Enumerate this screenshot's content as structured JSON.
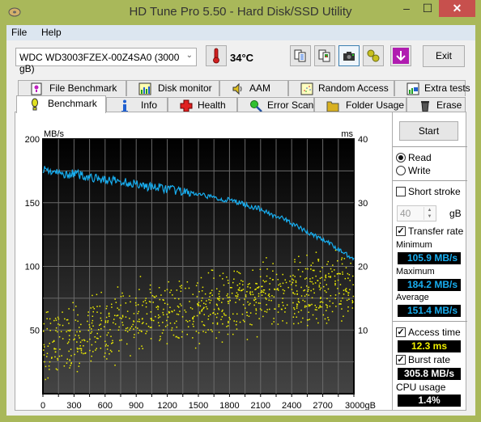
{
  "window": {
    "title": "HD Tune Pro 5.50 - Hard Disk/SSD Utility",
    "minimize_glyph": "–",
    "maximize_glyph": "☐",
    "close_glyph": "✕"
  },
  "menu": {
    "items": [
      {
        "label": "File"
      },
      {
        "label": "Help"
      }
    ]
  },
  "toolbar": {
    "drive": "WDC WD3003FZEX-00Z4SA0 (3000 gB)",
    "temperature": "34°C",
    "buttons": [
      {
        "icon": "copy-text-icon"
      },
      {
        "icon": "copy-screenshot-icon"
      },
      {
        "icon": "camera-icon"
      },
      {
        "icon": "options-icon"
      },
      {
        "icon": "save-down-icon"
      }
    ],
    "exit_label": "Exit"
  },
  "tabs": {
    "top_row": [
      {
        "label": "File Benchmark",
        "icon": "file-benchmark-icon"
      },
      {
        "label": "Disk monitor",
        "icon": "disk-monitor-icon"
      },
      {
        "label": "AAM",
        "icon": "speaker-icon"
      },
      {
        "label": "Random Access",
        "icon": "random-access-icon"
      },
      {
        "label": "Extra tests",
        "icon": "extra-tests-icon"
      }
    ],
    "bottom_row": [
      {
        "label": "Benchmark",
        "icon": "benchmark-icon",
        "active": true
      },
      {
        "label": "Info",
        "icon": "info-icon"
      },
      {
        "label": "Health",
        "icon": "health-cross-icon"
      },
      {
        "label": "Error Scan",
        "icon": "magnifier-icon"
      },
      {
        "label": "Folder Usage",
        "icon": "folder-icon"
      },
      {
        "label": "Erase",
        "icon": "trash-icon"
      }
    ]
  },
  "side": {
    "start_label": "Start",
    "read_label": "Read",
    "write_label": "Write",
    "mode_selected": "Read",
    "short_stroke_label": "Short stroke",
    "short_stroke_checked": false,
    "short_stroke_value": "40",
    "short_stroke_unit": "gB",
    "transfer_rate_label": "Transfer rate",
    "transfer_rate_checked": true,
    "minimum_label": "Minimum",
    "minimum_value": "105.9 MB/s",
    "maximum_label": "Maximum",
    "maximum_value": "184.2 MB/s",
    "average_label": "Average",
    "average_value": "151.4 MB/s",
    "access_time_label": "Access time",
    "access_time_checked": true,
    "access_time_value": "12.3 ms",
    "burst_rate_label": "Burst rate",
    "burst_rate_checked": true,
    "burst_rate_value": "305.8 MB/s",
    "cpu_label": "CPU usage",
    "cpu_value": "1.4%"
  },
  "colors": {
    "transfer_line": "#18aef0",
    "access_dots": "#f0f000",
    "plot_bg_top": "#000000",
    "plot_bg_bottom": "#444444",
    "grid": "#6a6a6a"
  },
  "chart_data": {
    "type": "line",
    "title": "",
    "xlabel": "gB",
    "ylabel_left": "MB/s",
    "ylabel_right": "ms",
    "xlim": [
      0,
      3000
    ],
    "ylim_left": [
      0,
      200
    ],
    "ylim_right": [
      0,
      40
    ],
    "x_ticks": [
      "0",
      "300",
      "600",
      "900",
      "1200",
      "1500",
      "1800",
      "2100",
      "2400",
      "2700",
      "3000gB"
    ],
    "y_ticks_left": [
      "200",
      "150",
      "100",
      "50"
    ],
    "y_ticks_right": [
      "40",
      "30",
      "20",
      "10"
    ],
    "grid": true,
    "series": [
      {
        "name": "Transfer rate (MB/s)",
        "axis": "left",
        "x": [
          0,
          100,
          200,
          300,
          400,
          500,
          600,
          700,
          800,
          900,
          1000,
          1100,
          1200,
          1300,
          1400,
          1500,
          1600,
          1700,
          1800,
          1900,
          2000,
          2100,
          2200,
          2300,
          2400,
          2500,
          2600,
          2700,
          2800,
          2900,
          3000
        ],
        "values": [
          177,
          174,
          172,
          173,
          171,
          169,
          168,
          167,
          166,
          165,
          163,
          162,
          161,
          159,
          158,
          156,
          155,
          153,
          152,
          150,
          147,
          145,
          141,
          138,
          134,
          129,
          125,
          121,
          116,
          111,
          106
        ]
      },
      {
        "name": "Access time (ms)",
        "axis": "right",
        "type": "scatter",
        "x_range": [
          0,
          3000
        ],
        "trend_ms": [
          [
            0,
            7
          ],
          [
            300,
            9
          ],
          [
            600,
            10.5
          ],
          [
            900,
            12
          ],
          [
            1200,
            13
          ],
          [
            1500,
            13.5
          ],
          [
            1800,
            14
          ],
          [
            2100,
            15
          ],
          [
            2400,
            16
          ],
          [
            2700,
            16.5
          ],
          [
            3000,
            17
          ]
        ],
        "spread_ms": 5.5
      }
    ]
  }
}
